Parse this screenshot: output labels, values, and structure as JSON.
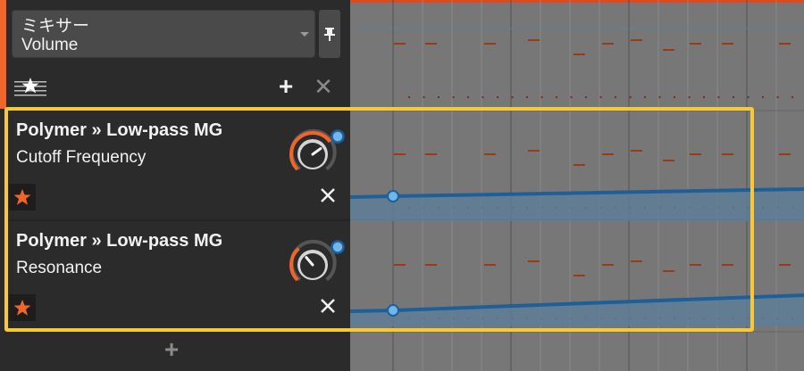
{
  "mixer": {
    "title": "ミキサー",
    "value": "Volume"
  },
  "toolbar": {
    "add_label": "+",
    "clear_label": "✕"
  },
  "parameters": [
    {
      "device": "Polymer » Low-pass MG",
      "name": "Cutoff Frequency",
      "knob_value": 0.7,
      "favorite": true
    },
    {
      "device": "Polymer » Low-pass MG",
      "name": "Resonance",
      "knob_value": 0.35,
      "favorite": true
    }
  ],
  "add_parameter_label": "+",
  "colors": {
    "accent": "#f0652a",
    "highlight": "#f6c83a",
    "automation": "#1f5f99",
    "automation_point": "#6fb6ef",
    "note_marks": "#9a3a17"
  },
  "icons": [
    "pin-icon",
    "favorites-filter-icon",
    "star-icon",
    "close-icon",
    "plus-icon"
  ]
}
